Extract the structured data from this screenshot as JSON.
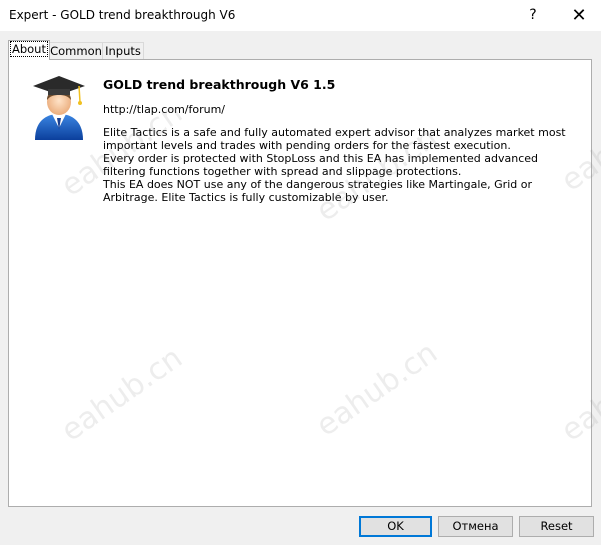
{
  "window": {
    "title": "Expert - GOLD trend breakthrough V6",
    "help_glyph": "?",
    "close_glyph": "✕"
  },
  "tabs": [
    {
      "label": "About"
    },
    {
      "label": "Common"
    },
    {
      "label": "Inputs"
    }
  ],
  "about": {
    "title": "GOLD trend breakthrough V6 1.5",
    "link": "http://tlap.com/forum/",
    "description": [
      "Elite Tactics is a safe and fully automated expert advisor that analyzes market most important levels and trades with pending orders for the fastest execution.",
      "Every order is protected with StopLoss and this EA has implemented advanced filtering functions together with spread and slippage protections.",
      "This EA does NOT use any of the dangerous strategies like Martingale, Grid or Arbitrage. Elite Tactics is fully customizable by user."
    ],
    "avatar_icon": "graduate-avatar-icon"
  },
  "watermark": "eahub.cn",
  "buttons": {
    "ok": "OK",
    "cancel": "Отмена",
    "reset": "Reset"
  }
}
